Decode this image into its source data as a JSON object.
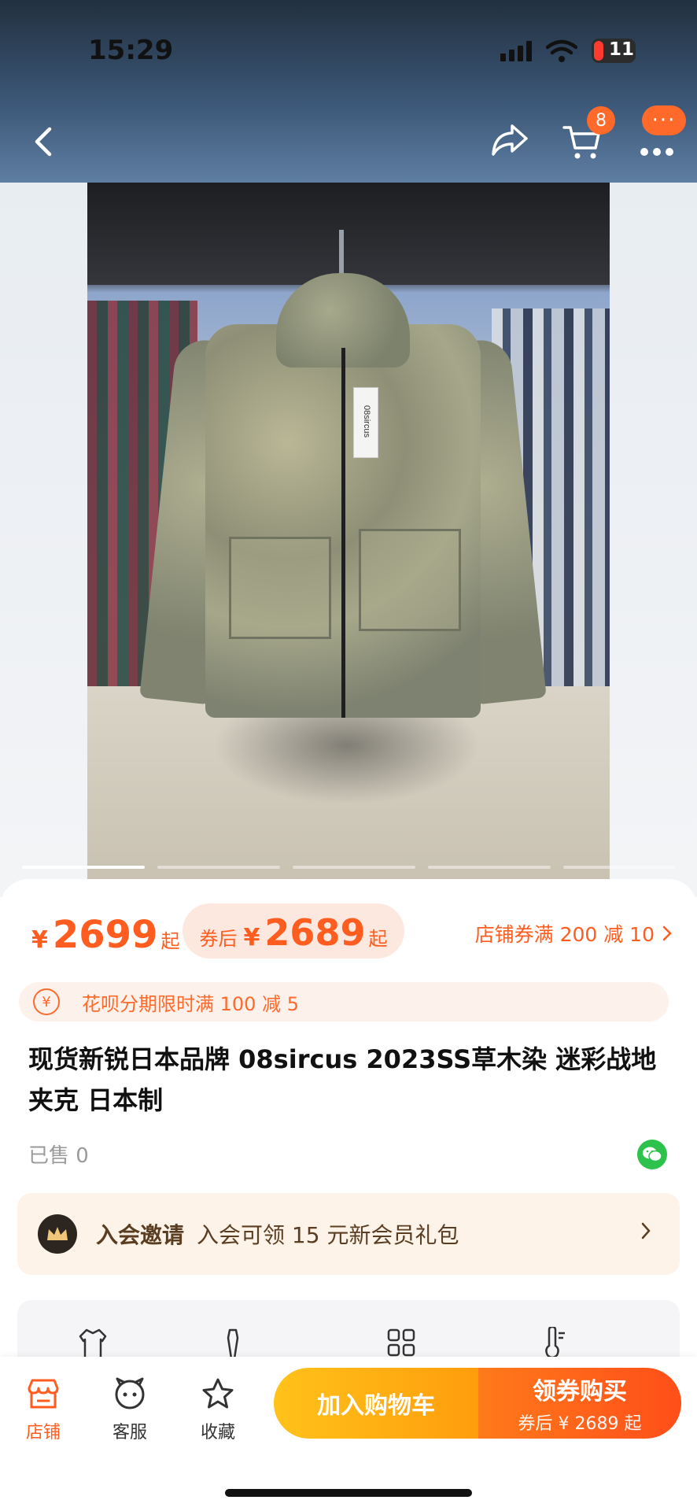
{
  "status_bar": {
    "time": "15:29",
    "battery": "11"
  },
  "nav": {
    "cart_badge": "8",
    "more_label": "···"
  },
  "product_image": {
    "tag_text": "08sircus"
  },
  "price": {
    "currency": "¥",
    "main": "2699",
    "main_suffix": "起",
    "coupon_label": "券后",
    "coupon_price": "2689",
    "coupon_suffix": "起",
    "store_coupon": "店铺券满 200 减 10"
  },
  "huabei": {
    "icon": "¥",
    "text": "花呗分期限时满 100 减 5"
  },
  "product": {
    "title": "现货新锐日本品牌 08sircus 2023SS草木染 迷彩战地夹克 日本制",
    "sold": "已售 0"
  },
  "member": {
    "title": "入会邀请",
    "desc": "入会可领 15 元新会员礼包"
  },
  "bottom_bar": {
    "tabs": [
      {
        "label": "店铺",
        "icon": "store-icon"
      },
      {
        "label": "客服",
        "icon": "service-icon"
      },
      {
        "label": "收藏",
        "icon": "star-icon"
      }
    ],
    "add_cart": "加入购物车",
    "buy_title": "领券购买",
    "buy_sub": "券后 ¥ 2689 起"
  },
  "colors": {
    "accent": "#ff5c1f",
    "cart_yellow": "#ffb214",
    "buy_orange": "#ff5a1a"
  }
}
